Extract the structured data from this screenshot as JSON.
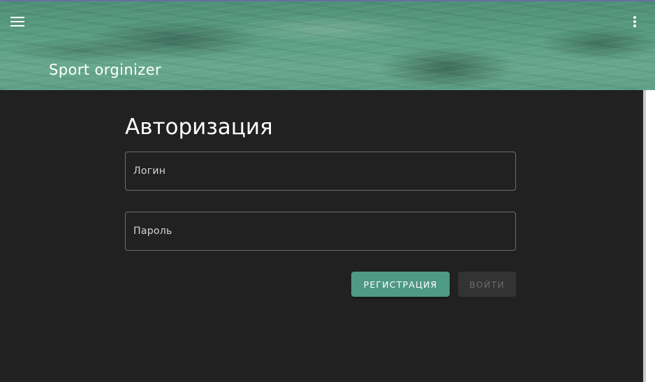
{
  "app_bar": {
    "title": "Sport orginizer",
    "menu_icon": "menu-icon",
    "more_icon": "more-vertical-icon"
  },
  "auth": {
    "title": "Авторизация",
    "login_placeholder": "Логин",
    "login_value": "",
    "password_placeholder": "Пароль",
    "password_value": "",
    "register_label": "РЕГИСТРАЦИЯ",
    "login_button_label": "ВОЙТИ",
    "login_button_disabled": true
  },
  "colors": {
    "background": "#212121",
    "accent": "#4f9a84",
    "header": "#5a9d84",
    "disabled_button": "#333333"
  }
}
